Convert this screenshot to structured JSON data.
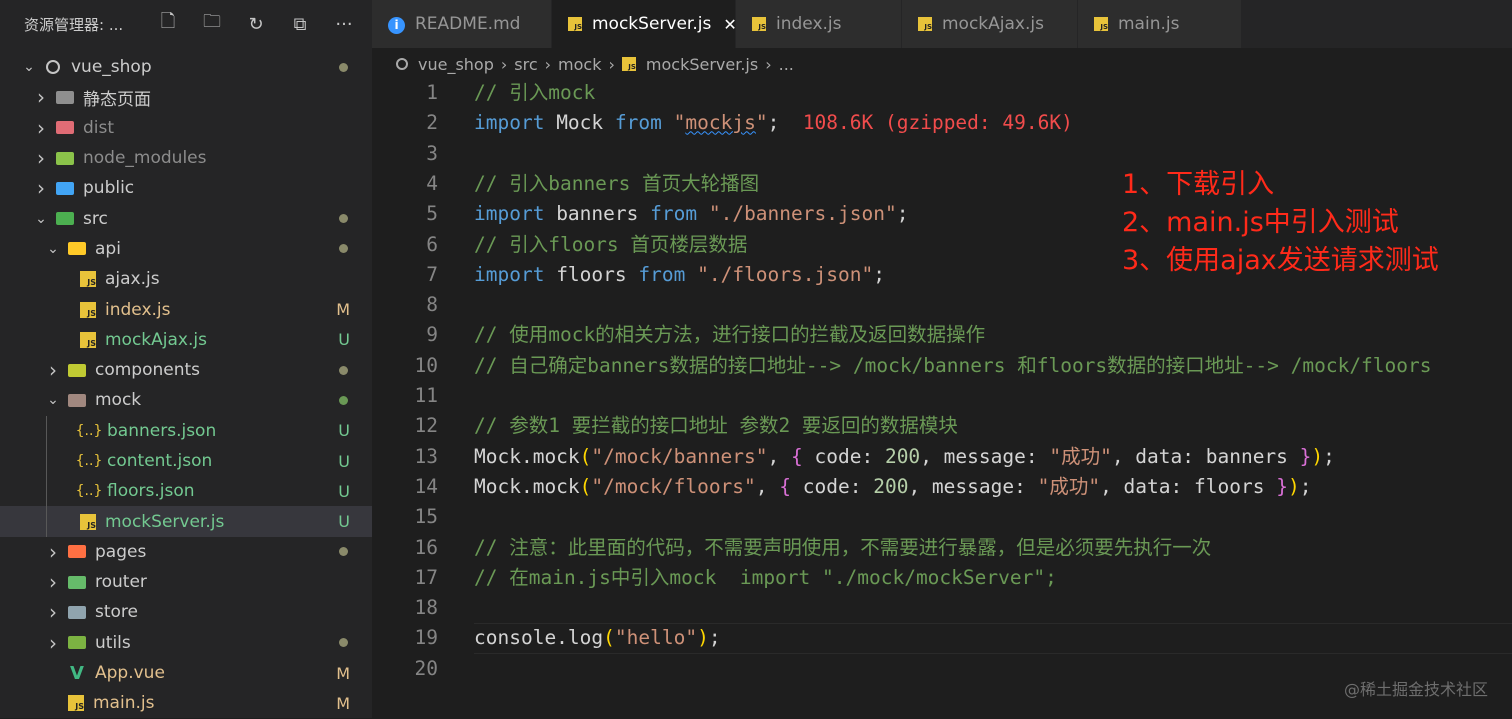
{
  "sidebar": {
    "title": "资源管理器: ...",
    "actions": [
      "new-file-icon",
      "new-folder-icon",
      "refresh-icon",
      "collapse-icon",
      "more-icon"
    ],
    "items": [
      {
        "label": "vue_shop",
        "depth": 0,
        "chev": "down",
        "icon": "circle",
        "status": "dot"
      },
      {
        "label": "静态页面",
        "depth": 1,
        "chev": "right",
        "icon": "folder-grey",
        "status": ""
      },
      {
        "label": "dist",
        "depth": 1,
        "chev": "right",
        "icon": "folder-red",
        "status": "",
        "dim": true
      },
      {
        "label": "node_modules",
        "depth": 1,
        "chev": "right",
        "icon": "folder-green",
        "status": "",
        "dim": true
      },
      {
        "label": "public",
        "depth": 1,
        "chev": "right",
        "icon": "folder-blue",
        "status": ""
      },
      {
        "label": "src",
        "depth": 1,
        "chev": "down",
        "icon": "folder-src",
        "status": "dot"
      },
      {
        "label": "api",
        "depth": 2,
        "chev": "down",
        "icon": "folder-api",
        "status": "dot"
      },
      {
        "label": "ajax.js",
        "depth": 3,
        "chev": "",
        "icon": "js",
        "status": ""
      },
      {
        "label": "index.js",
        "depth": 3,
        "chev": "",
        "icon": "js",
        "status": "M"
      },
      {
        "label": "mockAjax.js",
        "depth": 3,
        "chev": "",
        "icon": "js",
        "status": "U"
      },
      {
        "label": "components",
        "depth": 2,
        "chev": "right",
        "icon": "folder-comp",
        "status": "dot"
      },
      {
        "label": "mock",
        "depth": 2,
        "chev": "down",
        "icon": "folder-mock",
        "status": "dot-green"
      },
      {
        "label": "banners.json",
        "depth": 3,
        "chev": "",
        "icon": "json",
        "status": "U"
      },
      {
        "label": "content.json",
        "depth": 3,
        "chev": "",
        "icon": "json",
        "status": "U"
      },
      {
        "label": "floors.json",
        "depth": 3,
        "chev": "",
        "icon": "json",
        "status": "U"
      },
      {
        "label": "mockServer.js",
        "depth": 3,
        "chev": "",
        "icon": "js",
        "status": "U",
        "selected": true
      },
      {
        "label": "pages",
        "depth": 2,
        "chev": "right",
        "icon": "folder-pages",
        "status": "dot"
      },
      {
        "label": "router",
        "depth": 2,
        "chev": "right",
        "icon": "folder-router",
        "status": ""
      },
      {
        "label": "store",
        "depth": 2,
        "chev": "right",
        "icon": "folder-store",
        "status": ""
      },
      {
        "label": "utils",
        "depth": 2,
        "chev": "right",
        "icon": "folder-utils",
        "status": "dot"
      },
      {
        "label": "App.vue",
        "depth": 2,
        "chev": "",
        "icon": "vue",
        "status": "M"
      },
      {
        "label": "main.js",
        "depth": 2,
        "chev": "",
        "icon": "js",
        "status": "M"
      }
    ]
  },
  "tabs": [
    {
      "label": "README.md",
      "icon": "info",
      "active": false
    },
    {
      "label": "mockServer.js",
      "icon": "js",
      "active": true,
      "close": "✕"
    },
    {
      "label": "index.js",
      "icon": "js",
      "active": false
    },
    {
      "label": "mockAjax.js",
      "icon": "js",
      "active": false
    },
    {
      "label": "main.js",
      "icon": "js",
      "active": false
    }
  ],
  "breadcrumb": [
    "vue_shop",
    "src",
    "mock",
    "mockServer.js",
    "..."
  ],
  "editor": {
    "lines": [
      [
        [
          "cm",
          "// 引入mock"
        ]
      ],
      [
        [
          "kw",
          "import"
        ],
        [
          "pl",
          " Mock "
        ],
        [
          "kw",
          "from"
        ],
        [
          "pl",
          " "
        ],
        [
          "str",
          "\""
        ],
        [
          "strsq",
          "mockjs"
        ],
        [
          "str",
          "\""
        ],
        [
          "pl",
          ";  "
        ],
        [
          "sz",
          "108.6K (gzipped: 49.6K)"
        ]
      ],
      [],
      [
        [
          "cm",
          "// 引入banners 首页大轮播图"
        ]
      ],
      [
        [
          "kw",
          "import"
        ],
        [
          "pl",
          " banners "
        ],
        [
          "kw",
          "from"
        ],
        [
          "pl",
          " "
        ],
        [
          "str",
          "\"./banners.json\""
        ],
        [
          "pl",
          ";"
        ]
      ],
      [
        [
          "cm",
          "// 引入floors 首页楼层数据"
        ]
      ],
      [
        [
          "kw",
          "import"
        ],
        [
          "pl",
          " floors "
        ],
        [
          "kw",
          "from"
        ],
        [
          "pl",
          " "
        ],
        [
          "str",
          "\"./floors.json\""
        ],
        [
          "pl",
          ";"
        ]
      ],
      [],
      [
        [
          "cm",
          "// 使用mock的相关方法，进行接口的拦截及返回数据操作"
        ]
      ],
      [
        [
          "cm",
          "// 自己确定banners数据的接口地址--> /mock/banners 和floors数据的接口地址--> /mock/floors"
        ]
      ],
      [],
      [
        [
          "cm",
          "// 参数1 要拦截的接口地址 参数2 要返回的数据模块"
        ]
      ],
      [
        [
          "pl",
          "Mock.mock"
        ],
        [
          "br",
          "("
        ],
        [
          "str",
          "\"/mock/banners\""
        ],
        [
          "pl",
          ", "
        ],
        [
          "br2",
          "{"
        ],
        [
          "pl",
          " code: "
        ],
        [
          "num",
          "200"
        ],
        [
          "pl",
          ", message: "
        ],
        [
          "str",
          "\"成功\""
        ],
        [
          "pl",
          ", data: banners "
        ],
        [
          "br2",
          "}"
        ],
        [
          "br",
          ")"
        ],
        [
          "pl",
          ";"
        ]
      ],
      [
        [
          "pl",
          "Mock.mock"
        ],
        [
          "br",
          "("
        ],
        [
          "str",
          "\"/mock/floors\""
        ],
        [
          "pl",
          ", "
        ],
        [
          "br2",
          "{"
        ],
        [
          "pl",
          " code: "
        ],
        [
          "num",
          "200"
        ],
        [
          "pl",
          ", message: "
        ],
        [
          "str",
          "\"成功\""
        ],
        [
          "pl",
          ", data: floors "
        ],
        [
          "br2",
          "}"
        ],
        [
          "br",
          ")"
        ],
        [
          "pl",
          ";"
        ]
      ],
      [],
      [
        [
          "cm",
          "// 注意：此里面的代码，不需要声明使用，不需要进行暴露，但是必须要先执行一次"
        ]
      ],
      [
        [
          "cm",
          "// 在main.js中引入mock  import \"./mock/mockServer\";"
        ]
      ],
      [],
      [
        [
          "pl",
          "console.log"
        ],
        [
          "br",
          "("
        ],
        [
          "str",
          "\"hello\""
        ],
        [
          "br",
          ")"
        ],
        [
          "pl",
          ";"
        ]
      ],
      []
    ],
    "current_line": 19
  },
  "annotations": [
    "1、下载引入",
    "2、main.js中引入测试",
    "3、使用ajax发送请求测试"
  ],
  "watermark": "@稀土掘金技术社区",
  "colors": {
    "accent": "#3794ff",
    "annotation": "#ff2a1a",
    "modified": "#e2c08d",
    "untracked": "#73c991",
    "js_badge": "#e8c33a"
  }
}
